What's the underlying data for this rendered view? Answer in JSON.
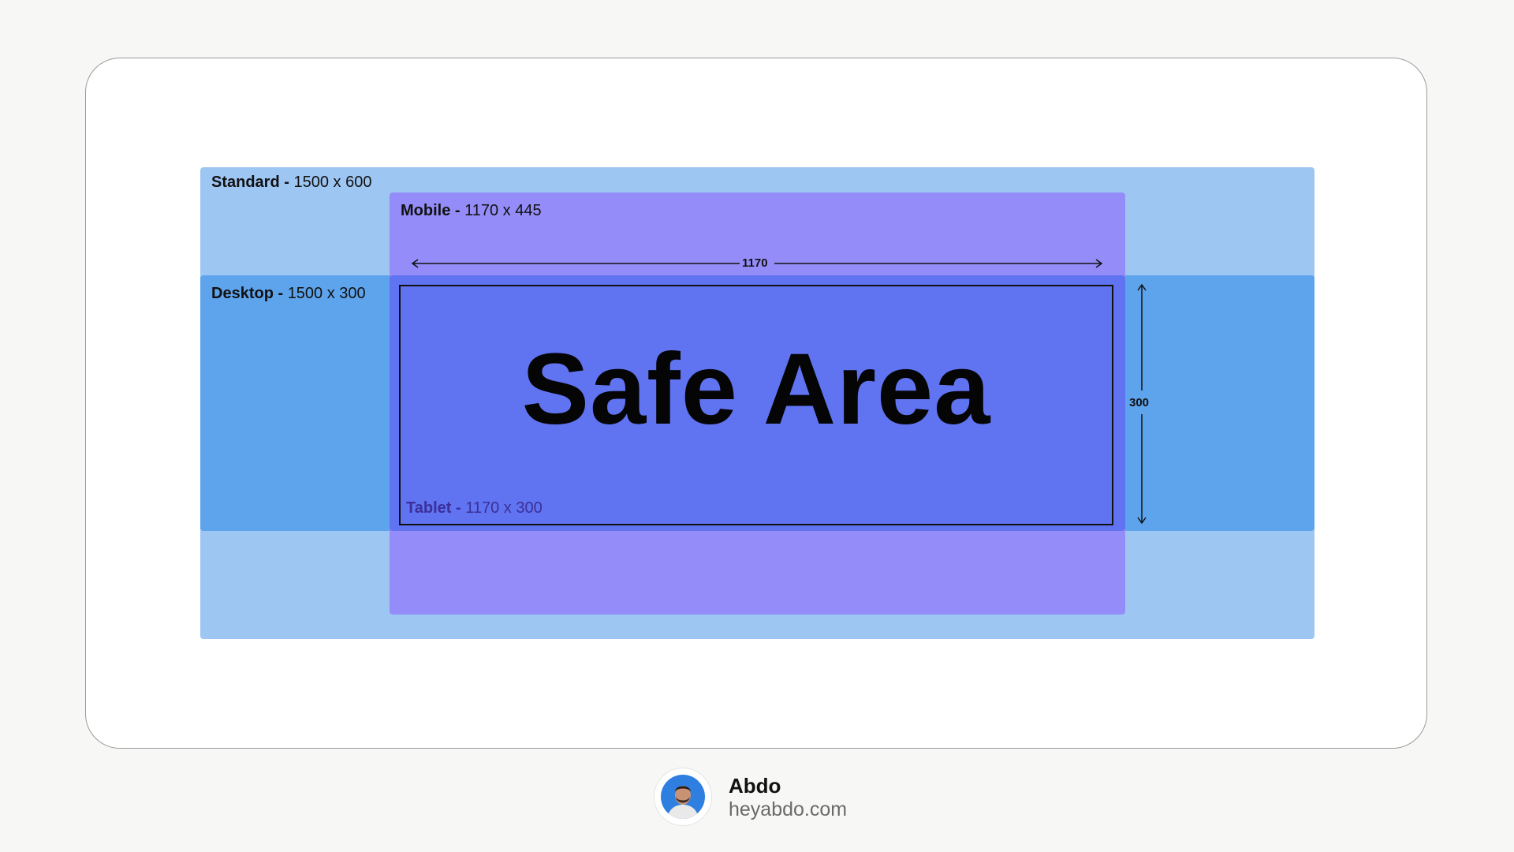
{
  "zones": {
    "standard": {
      "name": "Standard -",
      "size": "1500 x 600"
    },
    "mobile": {
      "name": "Mobile -",
      "size": "1170 x 445"
    },
    "desktop": {
      "name": "Desktop -",
      "size": "1500 x 300"
    },
    "tablet": {
      "name": "Tablet -",
      "size": "1170 x 300"
    }
  },
  "safe_area": {
    "title": "Safe Area"
  },
  "dimensions": {
    "width": "1170",
    "height": "300"
  },
  "colors": {
    "standard": "#9ec6f3",
    "desktop": "#5ea4ec",
    "mobile": "#948df9",
    "safe_area": "#6073f1"
  },
  "footer": {
    "avatar_icon": "person-avatar-icon",
    "name": "Abdo",
    "site": "heyabdo.com"
  }
}
